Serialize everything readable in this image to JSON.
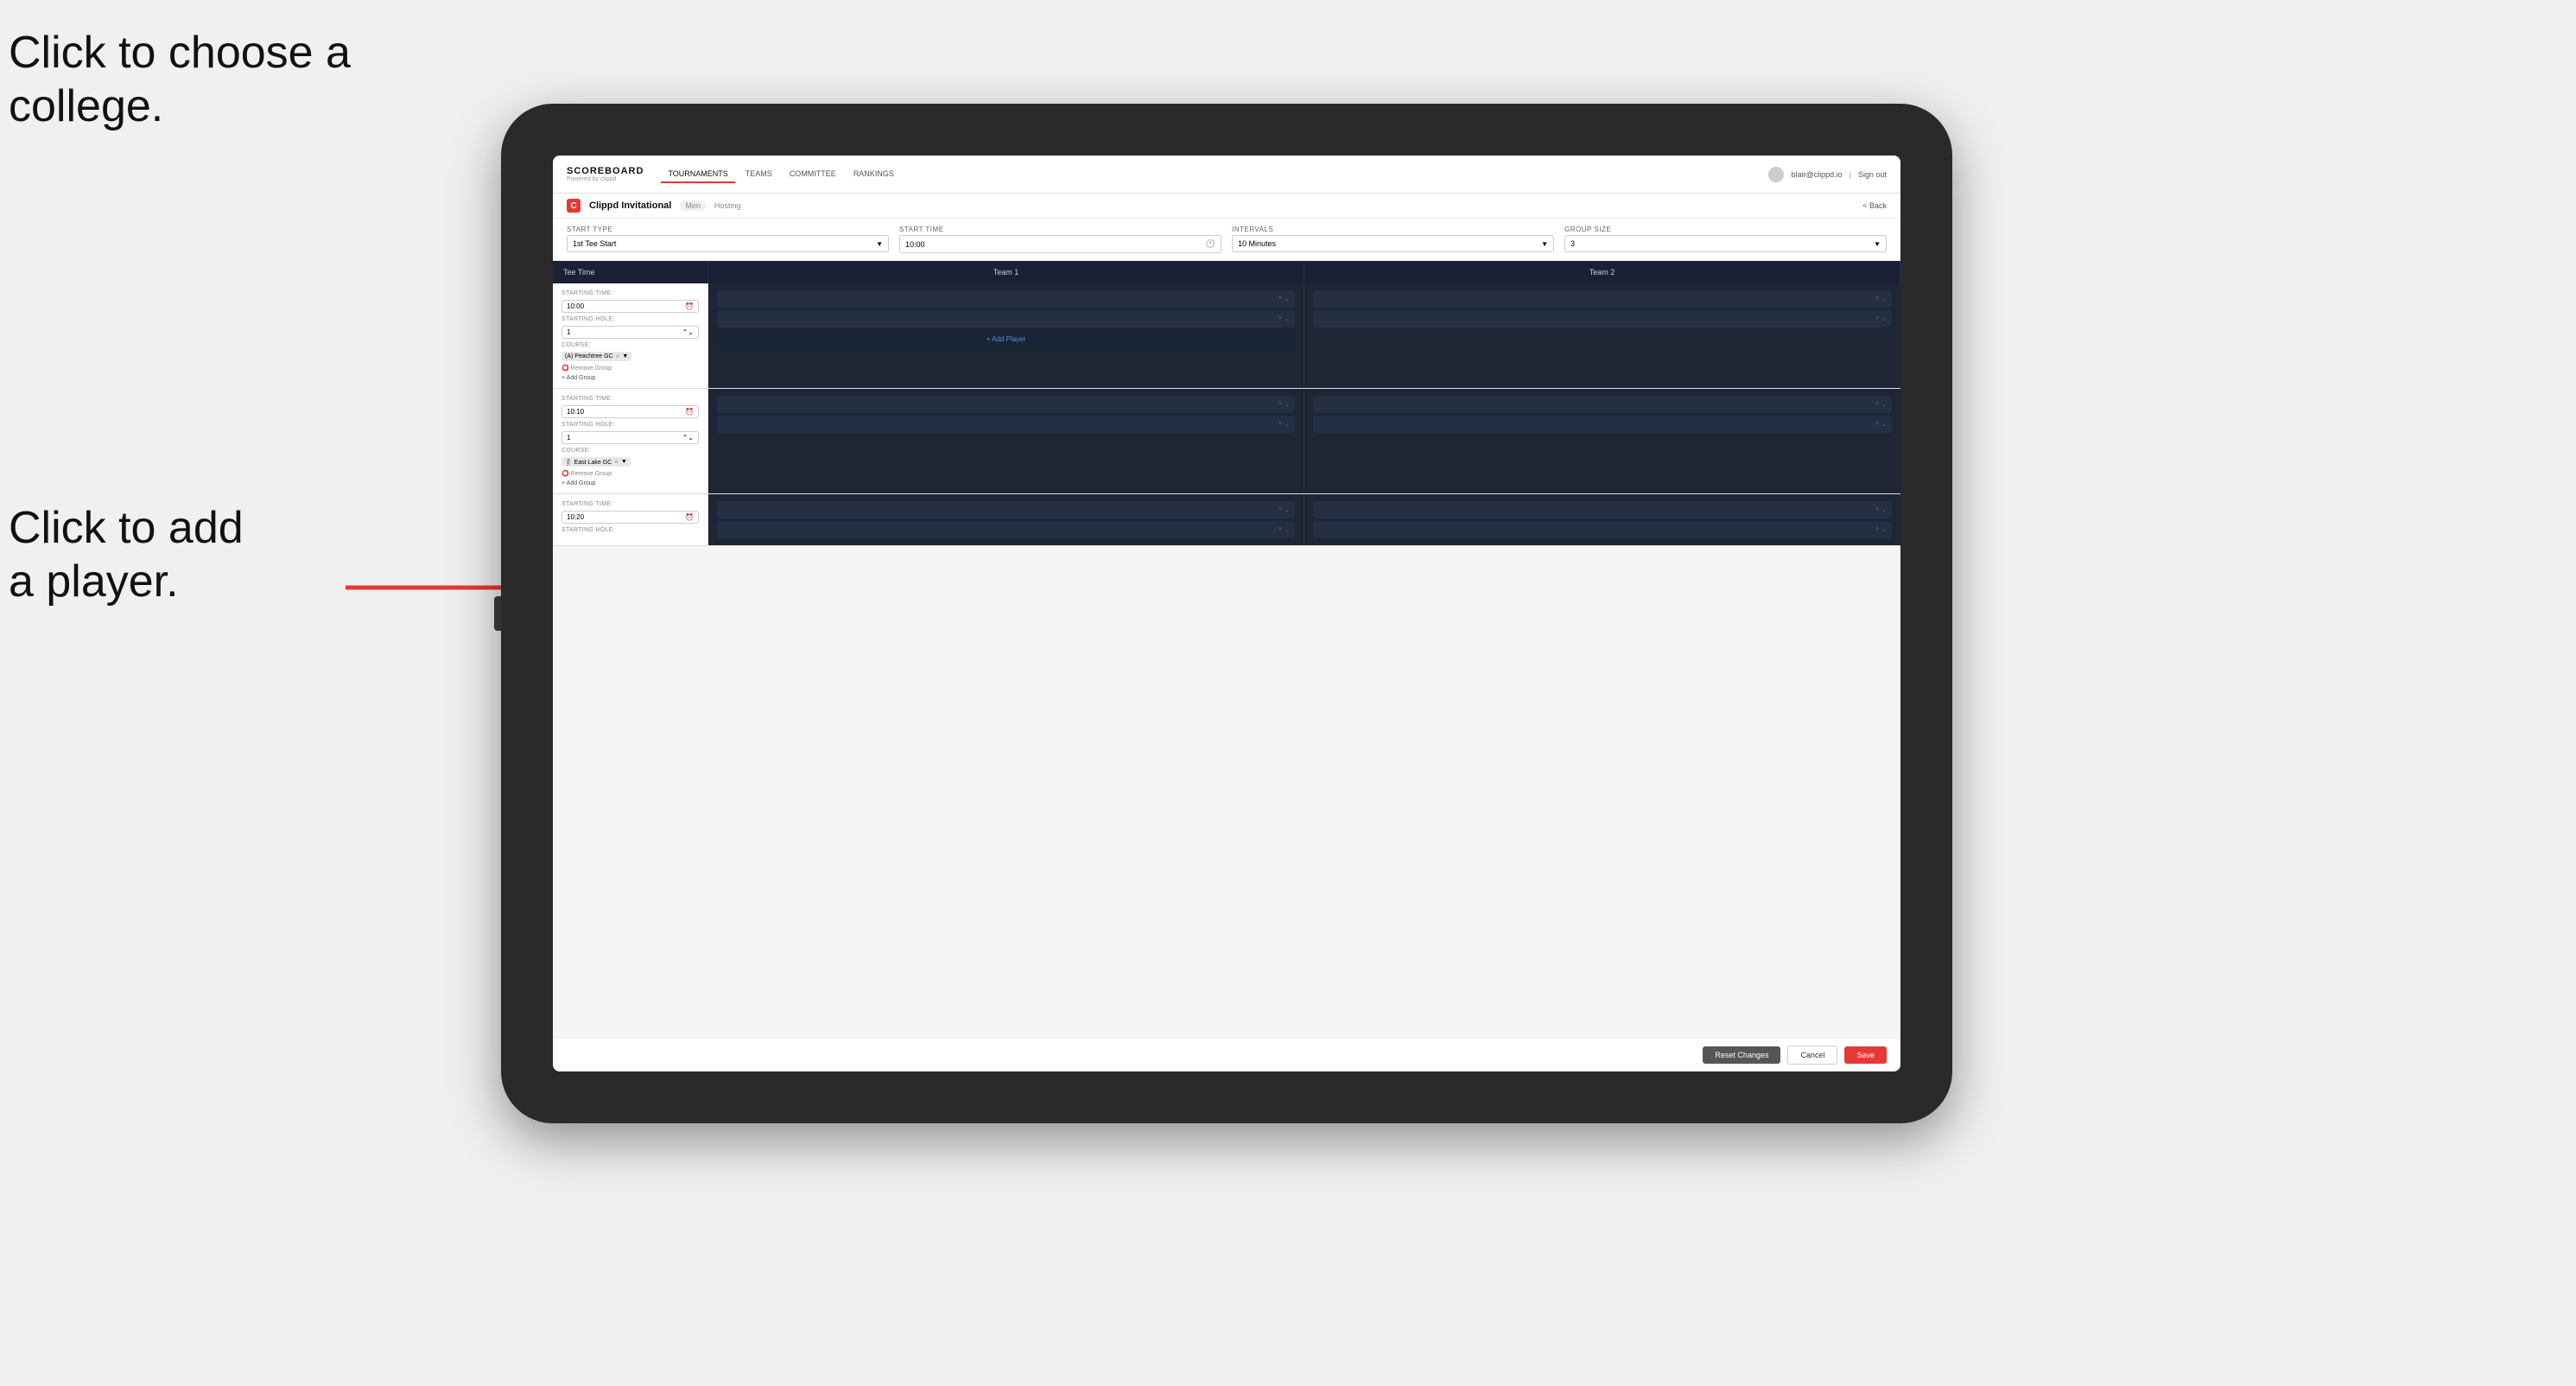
{
  "annotations": {
    "text1_line1": "Click to choose a",
    "text1_line2": "college.",
    "text2_line1": "Click to add",
    "text2_line2": "a player."
  },
  "nav": {
    "brand": "SCOREBOARD",
    "brand_sub": "Powered by clippd",
    "links": [
      "TOURNAMENTS",
      "TEAMS",
      "COMMITTEE",
      "RANKINGS"
    ],
    "active_link": "TOURNAMENTS",
    "user_email": "blair@clippd.io",
    "sign_out": "Sign out"
  },
  "sub_header": {
    "logo_letter": "C",
    "title": "Clippd Invitational",
    "badge": "Men",
    "tag": "Hosting",
    "back": "< Back"
  },
  "form": {
    "start_type_label": "Start Type",
    "start_type_value": "1st Tee Start",
    "start_time_label": "Start Time",
    "start_time_value": "10:00",
    "intervals_label": "Intervals",
    "intervals_value": "10 Minutes",
    "group_size_label": "Group Size",
    "group_size_value": "3"
  },
  "table": {
    "col1": "Tee Time",
    "col2": "Team 1",
    "col3": "Team 2"
  },
  "tee_times": [
    {
      "starting_time": "10:00",
      "starting_hole": "1",
      "course": "(A) Peachtree GC",
      "actions": [
        "Remove Group",
        "Add Group"
      ],
      "team1_players": 2,
      "team2_players": 2
    },
    {
      "starting_time": "10:10",
      "starting_hole": "1",
      "course": "East Lake GC",
      "course_icon": "🏌",
      "actions": [
        "Remove Group",
        "Add Group"
      ],
      "team1_players": 2,
      "team2_players": 2
    },
    {
      "starting_time": "10:20",
      "starting_hole": "",
      "course": "",
      "actions": [],
      "team1_players": 2,
      "team2_players": 2
    }
  ],
  "footer": {
    "reset_label": "Reset Changes",
    "cancel_label": "Cancel",
    "save_label": "Save"
  }
}
